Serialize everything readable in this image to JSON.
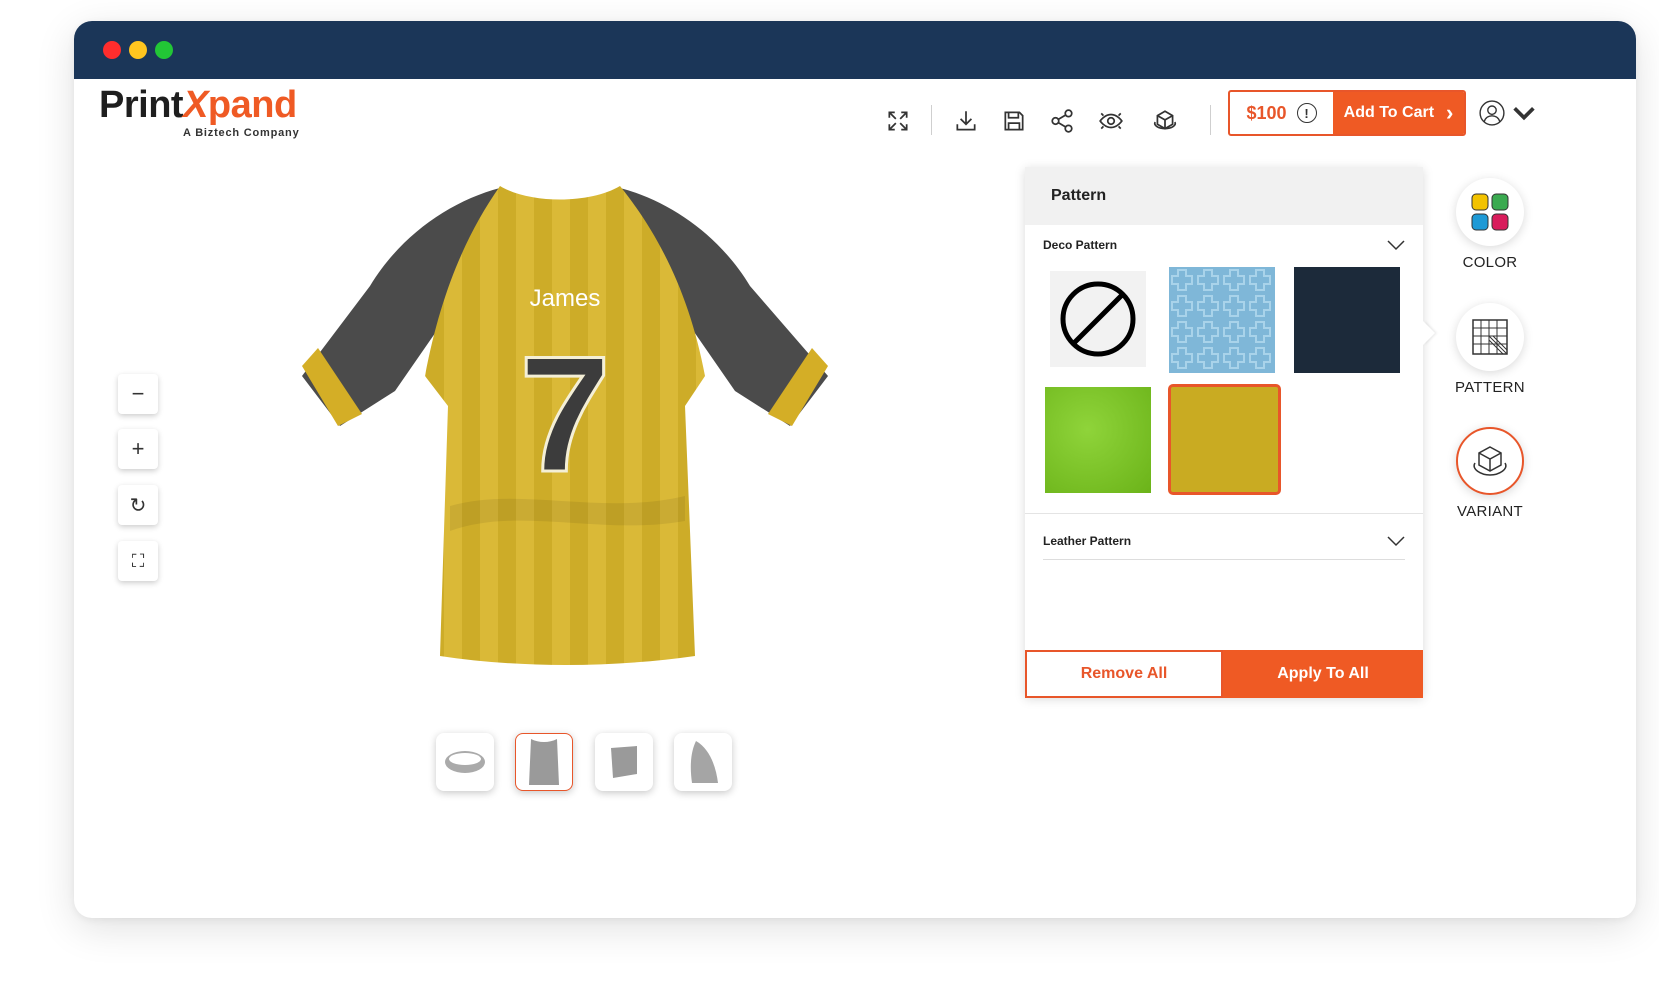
{
  "brand": {
    "print": "Print",
    "x": "X",
    "pand": "pand",
    "tagline": "A Biztech Company"
  },
  "toolbar": {
    "icons": [
      "expand-icon",
      "download-icon",
      "save-icon",
      "share-icon",
      "preview-icon",
      "3d-view-icon"
    ],
    "price": "$100",
    "info_glyph": "!",
    "add_to_cart": "Add To Cart",
    "add_to_cart_arrow": "›"
  },
  "product": {
    "name": "James",
    "number": "7",
    "colors": {
      "body": "#d8b52a",
      "sleeve": "#4b4b4b",
      "cuff": "#d4ae26",
      "number": "#3c3c3c"
    }
  },
  "zoom_controls": {
    "zoom_out": "−",
    "zoom_in": "+",
    "rotate": "↻",
    "fullscreen": "⛶"
  },
  "part_thumbnails": [
    "collar",
    "body",
    "front-panel",
    "sleeve"
  ],
  "pattern_panel": {
    "title": "Pattern",
    "sections": [
      {
        "label": "Deco Pattern",
        "swatches": [
          {
            "name": "none",
            "color": "#f2f2f2"
          },
          {
            "name": "blue-cross",
            "color": "#7fb7d8"
          },
          {
            "name": "dark-navy",
            "color": "#1c2a3a"
          },
          {
            "name": "green",
            "color": "#78c21b"
          },
          {
            "name": "gold",
            "color": "#c9ab22",
            "selected": true
          }
        ]
      },
      {
        "label": "Leather Pattern"
      }
    ],
    "remove_all": "Remove All",
    "apply_to_all": "Apply To All"
  },
  "side_nav": [
    {
      "label": "COLOR",
      "icon": "color-palette-icon"
    },
    {
      "label": "PATTERN",
      "icon": "pattern-icon"
    },
    {
      "label": "VARIANT",
      "icon": "variant-icon",
      "active": true
    }
  ],
  "accent_color": "#ef5a24"
}
